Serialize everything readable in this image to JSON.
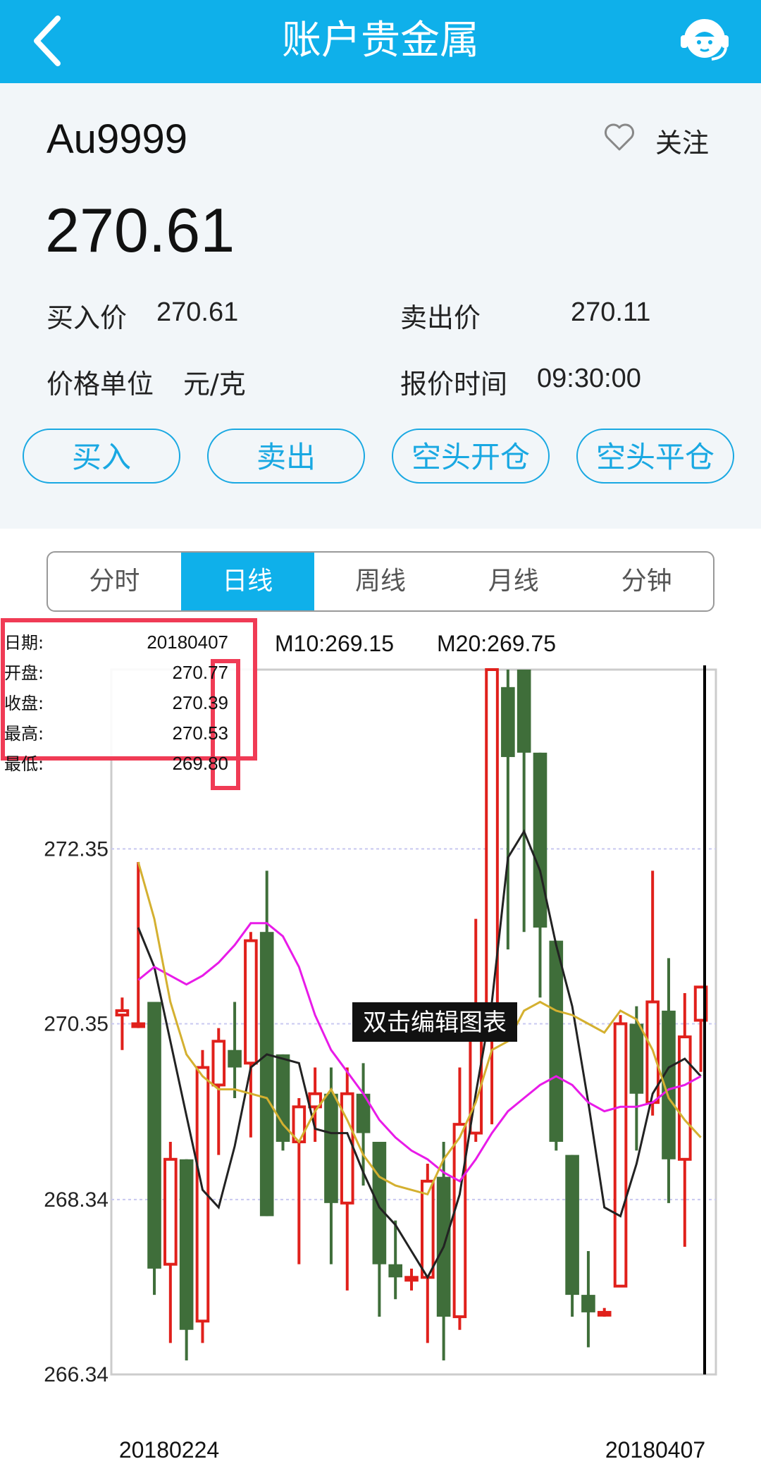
{
  "header": {
    "title": "账户贵金属",
    "back_icon": "chevron-left-icon",
    "service_icon": "customer-service-icon"
  },
  "quote": {
    "symbol": "Au9999",
    "follow_label": "关注",
    "price": "270.61",
    "buy_label": "买入价",
    "buy_value": "270.61",
    "sell_label": "卖出价",
    "sell_value": "270.11",
    "unit_label": "价格单位",
    "unit_value": "元/克",
    "time_label": "报价时间",
    "time_value": "09:30:00"
  },
  "actions": [
    "买入",
    "卖出",
    "空头开仓",
    "空头平仓"
  ],
  "tabs": [
    "分时",
    "日线",
    "周线",
    "月线",
    "分钟"
  ],
  "active_tab": "日线",
  "info_box": {
    "rows": [
      {
        "label": "日期:",
        "value": "20180407"
      },
      {
        "label": "开盘:",
        "value": "270.77"
      },
      {
        "label": "收盘:",
        "value": "270.39"
      },
      {
        "label": "最高:",
        "value": "270.53"
      },
      {
        "label": "最低:",
        "value": "269.80"
      }
    ]
  },
  "ma_labels": {
    "m10": "M10:269.15",
    "m20": "M20:269.75"
  },
  "edit_hint": "双击编辑图表",
  "chart_data": {
    "type": "candlestick",
    "y_ticks": [
      "272.35",
      "270.35",
      "268.34",
      "266.34"
    ],
    "ylim": [
      266.34,
      274.4
    ],
    "x_start_label": "20180224",
    "x_end_label": "20180407",
    "up_color": "#e0201b",
    "down_color": "#3f6e3a",
    "candles": [
      {
        "o": 270.45,
        "c": 270.5,
        "h": 270.65,
        "l": 270.05
      },
      {
        "o": 270.35,
        "c": 270.35,
        "h": 272.2,
        "l": 270.3
      },
      {
        "o": 270.6,
        "c": 267.55,
        "h": 270.6,
        "l": 267.25
      },
      {
        "o": 267.6,
        "c": 268.8,
        "h": 269.0,
        "l": 266.7
      },
      {
        "o": 268.8,
        "c": 266.85,
        "h": 268.8,
        "l": 266.5
      },
      {
        "o": 266.95,
        "c": 269.85,
        "h": 270.05,
        "l": 266.7
      },
      {
        "o": 269.65,
        "c": 270.15,
        "h": 270.3,
        "l": 268.85
      },
      {
        "o": 270.05,
        "c": 269.85,
        "h": 270.6,
        "l": 269.5
      },
      {
        "o": 269.9,
        "c": 271.3,
        "h": 271.4,
        "l": 269.05
      },
      {
        "o": 271.4,
        "c": 268.15,
        "h": 272.1,
        "l": 268.15
      },
      {
        "o": 270.0,
        "c": 269.0,
        "h": 270.0,
        "l": 268.9
      },
      {
        "o": 269.0,
        "c": 269.4,
        "h": 269.5,
        "l": 267.6
      },
      {
        "o": 269.4,
        "c": 269.55,
        "h": 269.85,
        "l": 269.0
      },
      {
        "o": 269.55,
        "c": 268.3,
        "h": 269.85,
        "l": 267.6
      },
      {
        "o": 268.3,
        "c": 269.55,
        "h": 269.85,
        "l": 267.3
      },
      {
        "o": 269.55,
        "c": 269.1,
        "h": 269.9,
        "l": 268.5
      },
      {
        "o": 269.0,
        "c": 267.6,
        "h": 269.0,
        "l": 267.0
      },
      {
        "o": 267.6,
        "c": 267.45,
        "h": 268.1,
        "l": 267.2
      },
      {
        "o": 267.45,
        "c": 267.45,
        "h": 267.55,
        "l": 267.3
      },
      {
        "o": 267.45,
        "c": 268.55,
        "h": 268.75,
        "l": 266.7
      },
      {
        "o": 268.6,
        "c": 267.0,
        "h": 269.0,
        "l": 266.5
      },
      {
        "o": 267.0,
        "c": 269.2,
        "h": 269.85,
        "l": 266.85
      },
      {
        "o": 269.1,
        "c": 270.45,
        "h": 271.55,
        "l": 269.0
      },
      {
        "o": 270.3,
        "c": 274.4,
        "h": 274.4,
        "l": 269.2
      },
      {
        "o": 274.2,
        "c": 273.4,
        "h": 274.4,
        "l": 271.2
      },
      {
        "o": 274.4,
        "c": 273.45,
        "h": 274.4,
        "l": 271.4
      },
      {
        "o": 273.45,
        "c": 271.45,
        "h": 273.45,
        "l": 270.65
      },
      {
        "o": 271.3,
        "c": 269.0,
        "h": 271.3,
        "l": 268.9
      },
      {
        "o": 268.85,
        "c": 267.25,
        "h": 268.85,
        "l": 267.0
      },
      {
        "o": 267.25,
        "c": 267.05,
        "h": 267.75,
        "l": 266.65
      },
      {
        "o": 267.05,
        "c": 267.05,
        "h": 267.1,
        "l": 267.0
      },
      {
        "o": 267.35,
        "c": 270.35,
        "h": 270.45,
        "l": 267.35
      },
      {
        "o": 270.35,
        "c": 269.55,
        "h": 270.55,
        "l": 268.9
      },
      {
        "o": 269.45,
        "c": 270.6,
        "h": 272.1,
        "l": 269.3
      },
      {
        "o": 270.5,
        "c": 268.8,
        "h": 271.1,
        "l": 268.3
      },
      {
        "o": 268.8,
        "c": 270.2,
        "h": 270.7,
        "l": 267.8
      },
      {
        "o": 270.39,
        "c": 270.77,
        "h": 270.53,
        "l": 269.8
      }
    ],
    "ma_lines": [
      {
        "name": "M10",
        "color": "#222222",
        "values": [
          271.45,
          271.0,
          270.15,
          269.3,
          268.45,
          268.25,
          268.95,
          269.85,
          270.0,
          269.95,
          269.9,
          269.15,
          269.1,
          269.1,
          268.65,
          268.25,
          268.05,
          267.75,
          267.45,
          267.8,
          268.4,
          269.55,
          270.6,
          272.25,
          272.55,
          272.1,
          271.25,
          270.55,
          269.45,
          268.25,
          268.15,
          268.75,
          269.55,
          269.85,
          269.95,
          269.75
        ]
      },
      {
        "name": "M20",
        "color": "#e81be8",
        "values": [
          270.85,
          271.0,
          270.9,
          270.8,
          270.9,
          271.05,
          271.25,
          271.5,
          271.5,
          271.35,
          271.0,
          270.45,
          270.05,
          269.8,
          269.55,
          269.25,
          269.05,
          268.9,
          268.8,
          268.65,
          268.55,
          268.8,
          269.1,
          269.35,
          269.5,
          269.65,
          269.75,
          269.65,
          269.45,
          269.35,
          269.4,
          269.4,
          269.45,
          269.6,
          269.65,
          269.75
        ]
      },
      {
        "name": "M5",
        "color": "#d4b030",
        "values": [
          272.2,
          271.55,
          270.6,
          270.0,
          269.75,
          269.6,
          269.6,
          269.55,
          269.5,
          269.2,
          269.0,
          269.35,
          269.6,
          269.25,
          268.85,
          268.6,
          268.5,
          268.45,
          268.4,
          268.8,
          269.05,
          269.45,
          270.05,
          270.15,
          270.5,
          270.6,
          270.5,
          270.45,
          270.35,
          270.25,
          270.5,
          270.4,
          270.05,
          269.5,
          269.25,
          269.05
        ]
      }
    ]
  }
}
